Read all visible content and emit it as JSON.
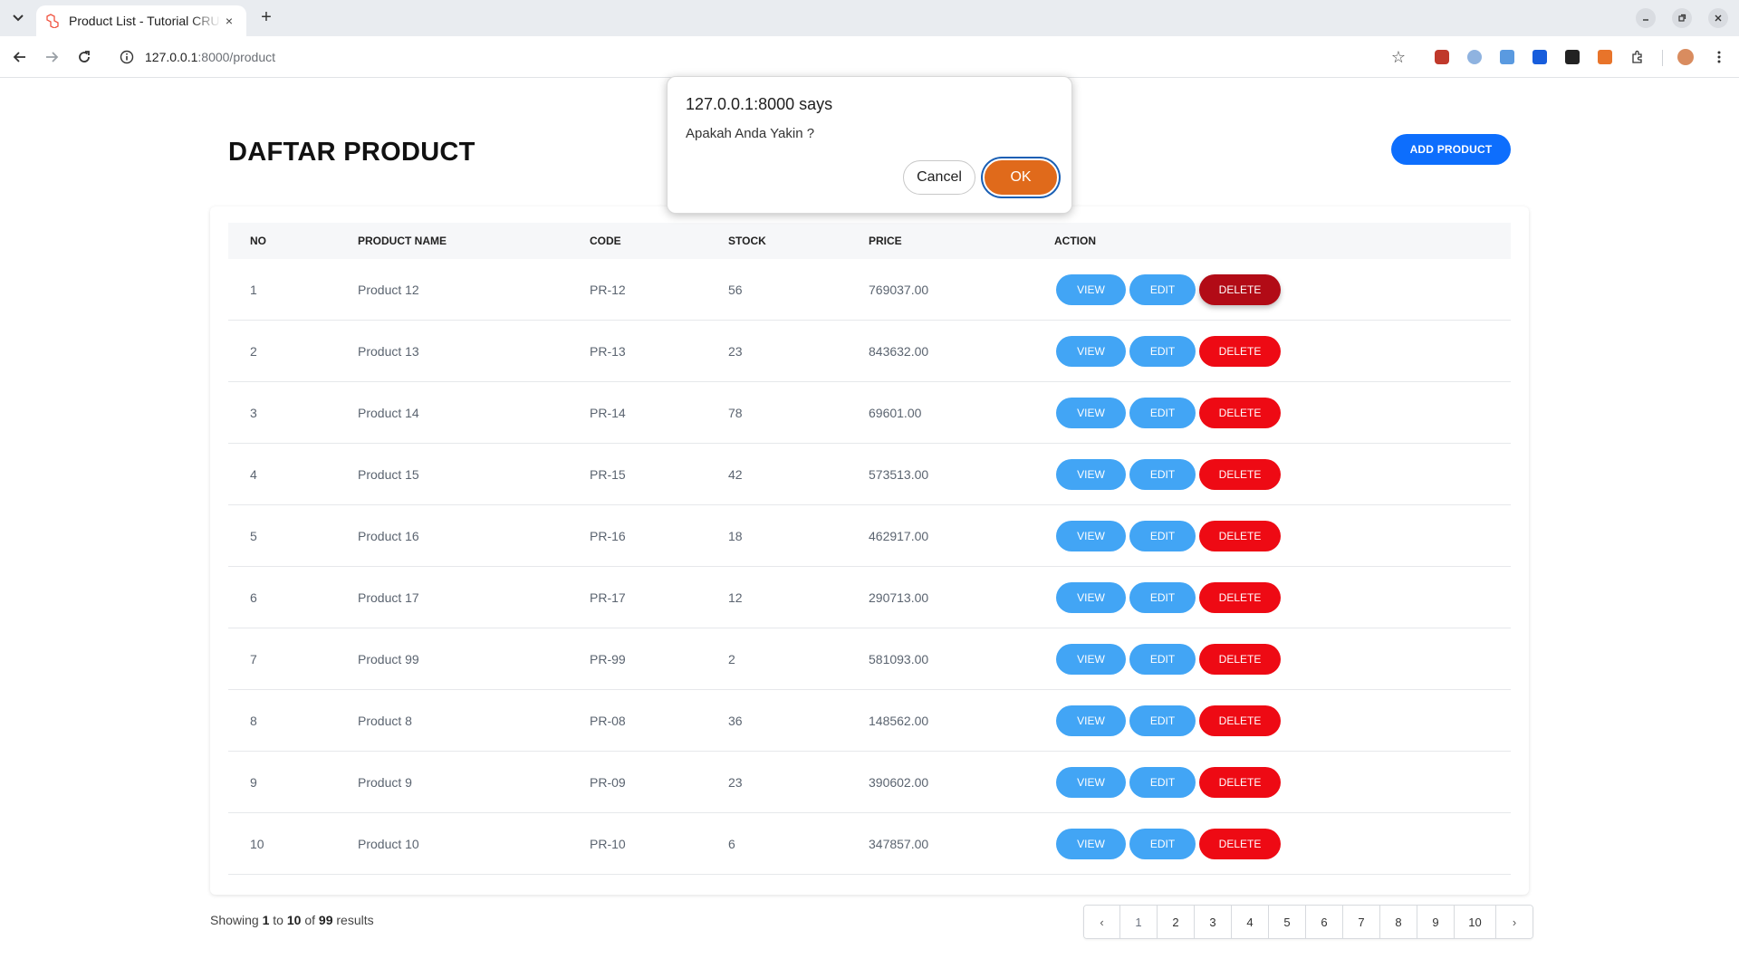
{
  "browser": {
    "tab_title": "Product List - Tutorial CRUD",
    "tab_close": "×",
    "new_tab": "+",
    "url_host": "127.0.0.1",
    "url_path": ":8000/product"
  },
  "page": {
    "title": "DAFTAR PRODUCT",
    "add_button": "ADD PRODUCT"
  },
  "table": {
    "headers": [
      "NO",
      "PRODUCT NAME",
      "CODE",
      "STOCK",
      "PRICE",
      "ACTION"
    ],
    "rows": [
      {
        "no": "1",
        "name": "Product 12",
        "code": "PR-12",
        "stock": "56",
        "price": "769037.00"
      },
      {
        "no": "2",
        "name": "Product 13",
        "code": "PR-13",
        "stock": "23",
        "price": "843632.00"
      },
      {
        "no": "3",
        "name": "Product 14",
        "code": "PR-14",
        "stock": "78",
        "price": "69601.00"
      },
      {
        "no": "4",
        "name": "Product 15",
        "code": "PR-15",
        "stock": "42",
        "price": "573513.00"
      },
      {
        "no": "5",
        "name": "Product 16",
        "code": "PR-16",
        "stock": "18",
        "price": "462917.00"
      },
      {
        "no": "6",
        "name": "Product 17",
        "code": "PR-17",
        "stock": "12",
        "price": "290713.00"
      },
      {
        "no": "7",
        "name": "Product 99",
        "code": "PR-99",
        "stock": "2",
        "price": "581093.00"
      },
      {
        "no": "8",
        "name": "Product 8",
        "code": "PR-08",
        "stock": "36",
        "price": "148562.00"
      },
      {
        "no": "9",
        "name": "Product 9",
        "code": "PR-09",
        "stock": "23",
        "price": "390602.00"
      },
      {
        "no": "10",
        "name": "Product 10",
        "code": "PR-10",
        "stock": "6",
        "price": "347857.00"
      }
    ],
    "view_label": "VIEW",
    "edit_label": "EDIT",
    "delete_label": "DELETE"
  },
  "summary": {
    "prefix": "Showing",
    "from": "1",
    "to_word": "to",
    "to": "10",
    "of_word": "of",
    "total": "99",
    "suffix": "results"
  },
  "pagination": {
    "prev": "‹",
    "next": "›",
    "pages": [
      "1",
      "2",
      "3",
      "4",
      "5",
      "6",
      "7",
      "8",
      "9",
      "10"
    ],
    "current": "1"
  },
  "dialog": {
    "title": "127.0.0.1:8000 says",
    "message": "Apakah Anda Yakin ?",
    "cancel": "Cancel",
    "ok": "OK"
  },
  "colors": {
    "primary": "#0d6efd",
    "view_edit": "#42a5f5",
    "delete": "#ee0a14",
    "delete_pressed": "#b20b16",
    "dialog_ok": "#e06a1b"
  }
}
